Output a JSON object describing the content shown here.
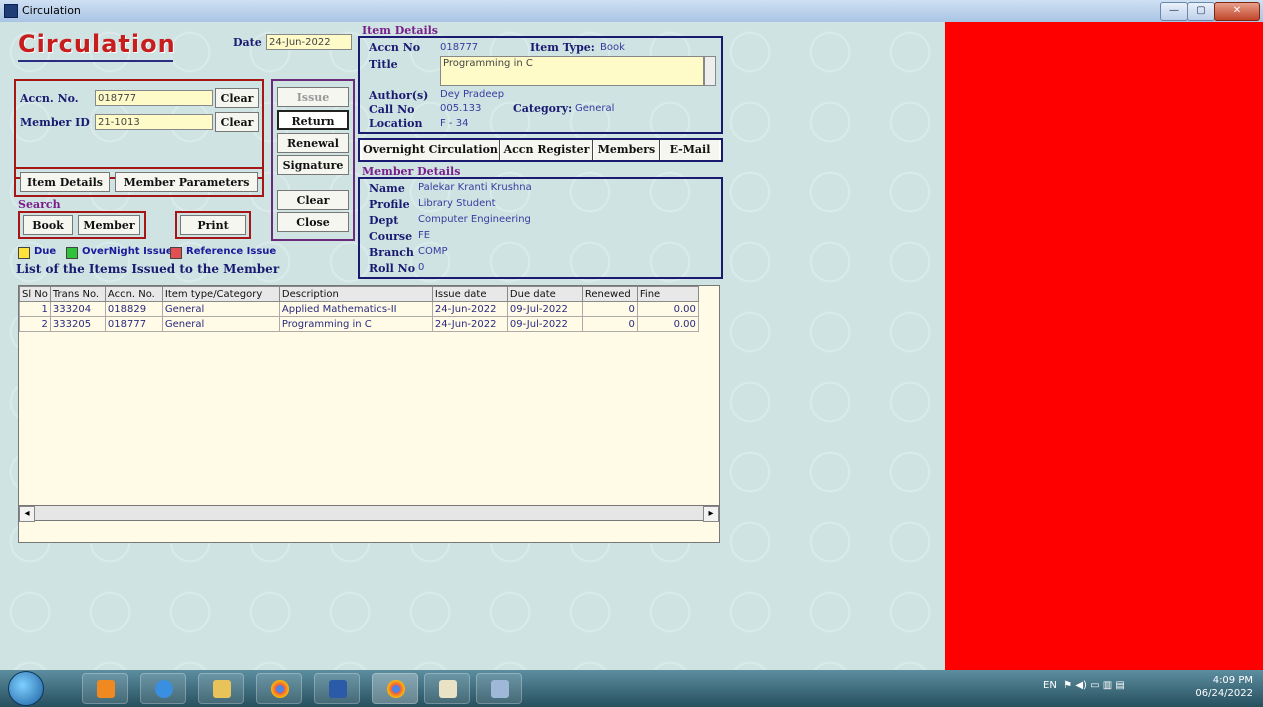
{
  "window": {
    "title": "Circulation",
    "min": "—",
    "max": "▢",
    "close": "✕"
  },
  "header": {
    "logo": "Circulation",
    "date_label": "Date",
    "date_value": "24-Jun-2022"
  },
  "entry": {
    "accn_label": "Accn. No.",
    "accn_value": "018777",
    "member_label": "Member ID",
    "member_value": "21-1013",
    "clear1": "Clear",
    "clear2": "Clear"
  },
  "actions": {
    "issue": "Issue",
    "return": "Return",
    "renewal": "Renewal",
    "signature": "Signature",
    "clear": "Clear",
    "close": "Close"
  },
  "links": {
    "item_details": "Item Details",
    "member_parameters": "Member Parameters"
  },
  "search": {
    "label": "Search",
    "book": "Book",
    "member": "Member",
    "print": "Print"
  },
  "legend": {
    "due": "Due",
    "overnight": "OverNight Issue",
    "reference": "Reference Issue"
  },
  "list_title": "List of the Items Issued to the Member",
  "item_details": {
    "section": "Item Details",
    "accn_label": "Accn No",
    "accn_value": "018777",
    "item_type_label": "Item Type:",
    "item_type_value": "Book",
    "title_label": "Title",
    "title_value": "Programming in C",
    "author_label": "Author(s)",
    "author_value": "Dey Pradeep",
    "callno_label": "Call No",
    "callno_value": "005.133",
    "category_label": "Category:",
    "category_value": "General",
    "location_label": "Location",
    "location_value": "F - 34"
  },
  "tabs": {
    "overnight": "Overnight Circulation",
    "accn_register": "Accn Register",
    "members": "Members",
    "email": "E-Mail"
  },
  "member_details": {
    "section": "Member Details",
    "name_label": "Name",
    "name_value": "Palekar Kranti Krushna",
    "profile_label": "Profile",
    "profile_value": "Library Student",
    "dept_label": "Dept",
    "dept_value": "Computer Engineering",
    "course_label": "Course",
    "course_value": "FE",
    "branch_label": "Branch",
    "branch_value": "COMP",
    "roll_label": "Roll No",
    "roll_value": "0"
  },
  "table": {
    "columns": [
      "Sl No",
      "Trans No.",
      "Accn. No.",
      "Item type/Category",
      "Description",
      "Issue date",
      "Due date",
      "Renewed",
      "Fine"
    ],
    "rows": [
      [
        "1",
        "333204",
        "018829",
        "General",
        "Applied Mathematics-II",
        "24-Jun-2022",
        "09-Jul-2022",
        "0",
        "0.00"
      ],
      [
        "2",
        "333205",
        "018777",
        "General",
        "Programming in C",
        "24-Jun-2022",
        "09-Jul-2022",
        "0",
        "0.00"
      ]
    ]
  },
  "scroll": {
    "left": "◂",
    "right": "▸"
  },
  "tray": {
    "lang": "EN",
    "time": "4:09 PM",
    "date": "06/24/2022"
  },
  "colors": {
    "panel": "#ff0000",
    "accent": "#c81d1d",
    "navy": "#1a1a70"
  }
}
